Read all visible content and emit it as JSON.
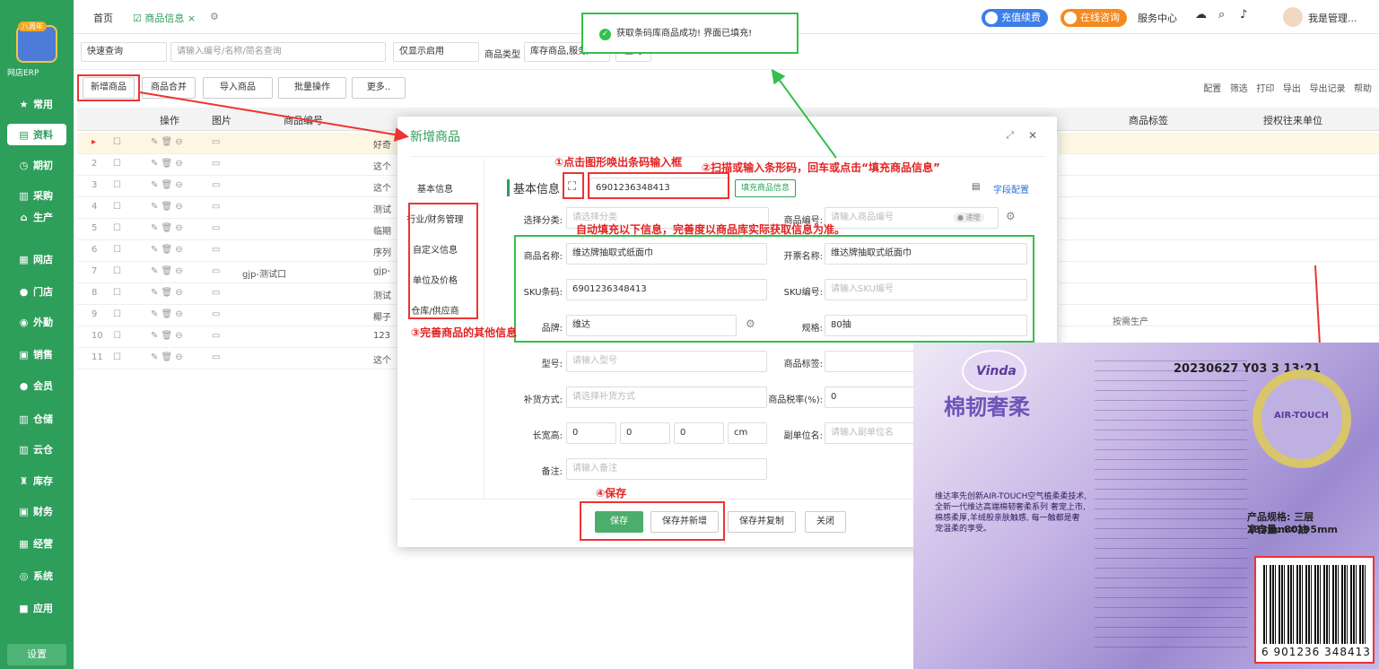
{
  "brand": {
    "badge": "八周年",
    "app_name": "网店ERP"
  },
  "sidebar": {
    "items": [
      {
        "label": "常用",
        "icon": "star-icon"
      },
      {
        "label": "资料",
        "icon": "doc-icon"
      },
      {
        "label": "期初",
        "icon": "clock-icon"
      },
      {
        "label": "采购",
        "icon": "cart-icon"
      },
      {
        "label": "生产",
        "icon": "factory-icon"
      },
      {
        "label": "网店",
        "icon": "shop-icon"
      },
      {
        "label": "门店",
        "icon": "store-icon"
      },
      {
        "label": "外勤",
        "icon": "field-icon"
      },
      {
        "label": "销售",
        "icon": "sales-icon"
      },
      {
        "label": "会员",
        "icon": "member-icon"
      },
      {
        "label": "仓储",
        "icon": "warehouse-icon"
      },
      {
        "label": "云仓",
        "icon": "cloud-icon"
      },
      {
        "label": "库存",
        "icon": "stock-icon"
      },
      {
        "label": "财务",
        "icon": "finance-icon"
      },
      {
        "label": "经营",
        "icon": "business-icon"
      },
      {
        "label": "系统",
        "icon": "system-icon"
      },
      {
        "label": "应用",
        "icon": "app-icon"
      }
    ],
    "settings": "设置"
  },
  "topbar": {
    "home": "首页",
    "tab_active": "商品信息",
    "tab_close": "×",
    "recharge": "充值续费",
    "consult": "在线咨询",
    "service": "服务中心",
    "user": "我是管理...",
    "accent": "#2e9e5b"
  },
  "search": {
    "mode": "快速查询",
    "placeholder": "请输入编号/名称/简名查询",
    "enabled": "仅显示启用",
    "type_label": "商品类型",
    "type_value": "库存商品,服务/...",
    "query": "查询"
  },
  "toolbar": {
    "add": "新增商品",
    "merge": "商品合并",
    "import": "导入商品",
    "batch": "批量操作",
    "more": "更多..",
    "config": "配置",
    "filter": "筛选",
    "print": "打印",
    "export": "导出",
    "export_log": "导出记录",
    "help": "帮助"
  },
  "grid": {
    "headers": {
      "op": "操作",
      "img": "图片",
      "code": "商品编号",
      "tag": "商品标签",
      "unit": "授权往来单位"
    },
    "rows": [
      {
        "n": "▸",
        "code": "",
        "name": "好奇"
      },
      {
        "n": "2",
        "code": "",
        "name": "这个"
      },
      {
        "n": "3",
        "code": "",
        "name": "这个"
      },
      {
        "n": "4",
        "code": "",
        "name": "测试"
      },
      {
        "n": "5",
        "code": "",
        "name": "临期"
      },
      {
        "n": "6",
        "code": "",
        "name": "序列"
      },
      {
        "n": "7",
        "code": "gjp-测试口",
        "name": "gjp-"
      },
      {
        "n": "8",
        "code": "",
        "name": "测试"
      },
      {
        "n": "9",
        "code": "",
        "name": "椰子"
      },
      {
        "n": "10",
        "code": "",
        "name": "123"
      },
      {
        "n": "11",
        "code": "",
        "name": "这个"
      }
    ],
    "row8_tag": "按需生产"
  },
  "toast": {
    "text": "获取条码库商品成功! 界面已填充!"
  },
  "modal": {
    "title": "新增商品",
    "nav": [
      "基本信息",
      "行业/财务管理",
      "自定义信息",
      "单位及价格",
      "仓库/供应商"
    ],
    "section": "基本信息",
    "barcode_value": "6901236348413",
    "fill_button": "填充商品信息",
    "field_config": "字段配置",
    "fields": {
      "category_label": "选择分类:",
      "category_ph": "请选择分类",
      "code_label": "商品编号:",
      "code_ph": "请输入商品编号",
      "code_auto": "● 递增",
      "name_label": "商品名称:",
      "name_value": "维达牌抽取式纸面巾",
      "invoice_label": "开票名称:",
      "invoice_value": "维达牌抽取式纸面巾",
      "sku_label": "SKU条码:",
      "sku_value": "6901236348413",
      "skucode_label": "SKU编号:",
      "skucode_ph": "请输入SKU编号",
      "brand_label": "品牌:",
      "brand_value": "维达",
      "spec_label": "规格:",
      "spec_value": "80抽",
      "model_label": "型号:",
      "model_ph": "请输入型号",
      "tag_label": "商品标签:",
      "replenish_label": "补货方式:",
      "replenish_ph": "请选择补货方式",
      "tax_label": "商品税率(%):",
      "tax_value": "0",
      "dims_label": "长宽高:",
      "dim1": "0",
      "dim2": "0",
      "dim3": "0",
      "dim_unit": "cm",
      "subunit_label": "副单位名:",
      "subunit_ph": "请输入副单位名",
      "note_label": "备注:",
      "note_ph": "请输入备注"
    },
    "buttons": {
      "save": "保存",
      "save_new": "保存并新增",
      "save_copy": "保存并复制",
      "close": "关闭"
    }
  },
  "annotations": {
    "a1": "①点击图形唤出条码输入框",
    "a2": "②扫描或输入条形码，回车或点击“填充商品信息”",
    "a_auto": "自动填充以下信息，完善度以商品库实际获取信息为准。",
    "a3": "③完善商品的其他信息",
    "a4": "④保存"
  },
  "photo": {
    "brand": "Vinda",
    "slogan": "棉韧奢柔",
    "date": "20230627 Y03 3 13:21",
    "spec_line": "产品规格: 三层 133mm×195mm",
    "net": "净含量: 80抽",
    "barcode": "6 901236 348413",
    "desc": "维达率先创新AIR-TOUCH空气植柔柔技术,全新一代维达高端棉韧奢柔系列 奢宠上市,棉感柔厚,羊绒般亲肤触感, 每一触都是奢宠温柔的享受。",
    "badge": "AIR-TOUCH"
  }
}
